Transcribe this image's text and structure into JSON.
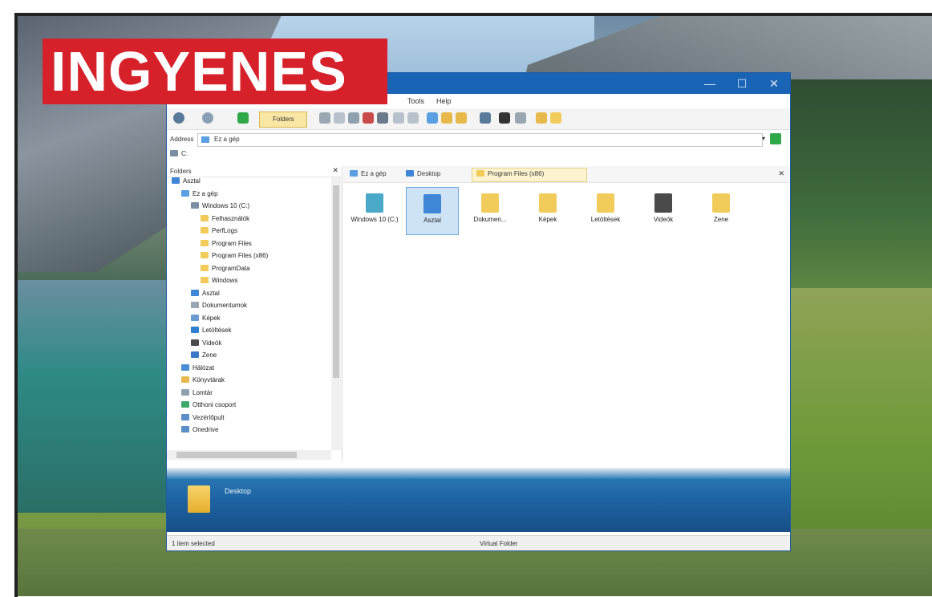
{
  "banner": {
    "text": "INGYENES",
    "color": "#d6202a"
  },
  "window": {
    "title_buttons": [
      "—",
      "☐",
      "✕"
    ],
    "menu": [
      "Tools",
      "Help"
    ],
    "toolbar": {
      "folders_label": "Folders"
    },
    "address": {
      "label": "Address",
      "value": "Ez a gép"
    },
    "drive_row": "C:",
    "folders_pane": {
      "header": "Folders",
      "close": "✕",
      "tree": [
        {
          "label": "Asztal",
          "level": 0,
          "color": "#3f86d6"
        },
        {
          "label": "Ez a gép",
          "level": 1,
          "color": "#5aa0e0"
        },
        {
          "label": "Windows 10 (C:)",
          "level": 2,
          "color": "#7a8fa3"
        },
        {
          "label": "Felhasználók",
          "level": 3,
          "color": "#f2cc5a"
        },
        {
          "label": "PerfLogs",
          "level": 3,
          "color": "#f2cc5a"
        },
        {
          "label": "Program Files",
          "level": 3,
          "color": "#f2cc5a"
        },
        {
          "label": "Program Files (x86)",
          "level": 3,
          "color": "#f2cc5a"
        },
        {
          "label": "ProgramData",
          "level": 3,
          "color": "#f2cc5a"
        },
        {
          "label": "Windows",
          "level": 3,
          "color": "#f2cc5a"
        },
        {
          "label": "Asztal",
          "level": 2,
          "color": "#3f86d6"
        },
        {
          "label": "Dokumentumok",
          "level": 2,
          "color": "#9aa6b2"
        },
        {
          "label": "Képek",
          "level": 2,
          "color": "#6a9ad0"
        },
        {
          "label": "Letöltések",
          "level": 2,
          "color": "#2f7fd0"
        },
        {
          "label": "Videók",
          "level": 2,
          "color": "#4a4a4a"
        },
        {
          "label": "Zene",
          "level": 2,
          "color": "#3a78c8"
        },
        {
          "label": "Hálózat",
          "level": 1,
          "color": "#4a8fd6"
        },
        {
          "label": "Könyvtárak",
          "level": 1,
          "color": "#e6b94a"
        },
        {
          "label": "Lomtár",
          "level": 1,
          "color": "#8fa0ae"
        },
        {
          "label": "Otthoni csoport",
          "level": 1,
          "color": "#3ea86a"
        },
        {
          "label": "Vezérlőpult",
          "level": 1,
          "color": "#5a8fc8"
        },
        {
          "label": "Onedrive",
          "level": 1,
          "color": "#5a8fc8"
        }
      ]
    },
    "breadcrumbs": [
      "Ez a gép",
      "Desktop",
      "Program Files (x86)"
    ],
    "crumbs_close": "✕",
    "icons": [
      {
        "label": "Windows 10 (C:)",
        "color": "#4aa8c8",
        "selected": false
      },
      {
        "label": "Asztal",
        "color": "#3f86d6",
        "selected": true
      },
      {
        "label": "Dokumen...",
        "color": "#f2cc5a",
        "selected": false
      },
      {
        "label": "Képek",
        "color": "#f2cc5a",
        "selected": false
      },
      {
        "label": "Letöltések",
        "color": "#f2cc5a",
        "selected": false
      },
      {
        "label": "Videók",
        "color": "#4a4a4a",
        "selected": false
      },
      {
        "label": "Zene",
        "color": "#f2cc5a",
        "selected": false
      }
    ],
    "details": {
      "name": "Desktop"
    },
    "status": {
      "left": "1 item selected",
      "middle": "Virtual Folder"
    }
  }
}
